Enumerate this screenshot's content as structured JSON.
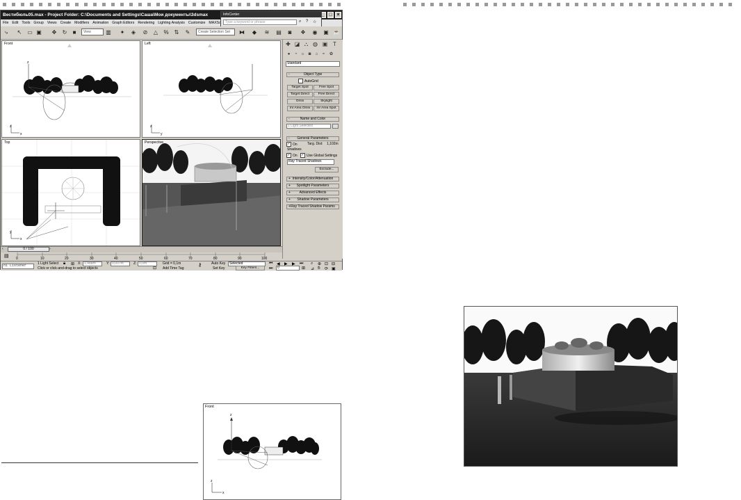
{
  "window": {
    "title": "Вестибюль05.max  - Project Folder: C:\\Documents and Settings\\Саша\\Мои документы\\3dsmax",
    "min_glyph": "_",
    "max_glyph": "□",
    "close_glyph": "×"
  },
  "infocenter": {
    "title": "InfoCenter",
    "search_placeholder": "Type a keyword or phrase"
  },
  "menu": [
    "File",
    "Edit",
    "Tools",
    "Group",
    "Views",
    "Create",
    "Modifiers",
    "Animation",
    "Graph Editors",
    "Rendering",
    "Lighting Analysis",
    "Customize",
    "MAXScript"
  ],
  "toolbar": {
    "reference_coord": "View",
    "named_selection": "Create Selection Set"
  },
  "viewports": {
    "front": "Front",
    "left": "Left",
    "top": "Top",
    "perspective": "Perspective"
  },
  "axes": {
    "x": "x",
    "y": "y",
    "z": "z"
  },
  "command_panel": {
    "category_dropdown": "Standard",
    "object_type": {
      "header": "Object Type",
      "autogrid": "AutoGrid",
      "buttons": [
        "Target Spot",
        "Free Spot",
        "Target Direct",
        "Free Direct",
        "Omni",
        "Skylight",
        "mr Area Omni",
        "mr Area Spot"
      ]
    },
    "name_and_color": {
      "header": "Name and Color",
      "name_value": "1 Light Selected"
    },
    "general_parameters": {
      "header": "General Parameters",
      "on_label": "On",
      "targ_dist_label": "Targ. Dist:",
      "targ_dist_value": "1,102m",
      "shadows_label": "Shadows",
      "shadows_on": "On",
      "use_global": "Use Global Settings",
      "shadow_type": "Ray Traced Shadows",
      "exclude": "Exclude..."
    },
    "rollouts": [
      "Intensity/Color/Attenuation",
      "Spotlight Parameters",
      "Advanced Effects",
      "Shadow Parameters",
      "Ray Traced Shadow Params"
    ]
  },
  "timeline": {
    "slider": "0 / 100",
    "ticks": [
      "0",
      "10",
      "20",
      "30",
      "40",
      "50",
      "60",
      "70",
      "80",
      "90",
      "100"
    ]
  },
  "status": {
    "maxscript_listener": "ni Listener",
    "selection_info": "1 Light Select",
    "x_label": "X:",
    "x_value": "1,488m",
    "y_label": "Y:",
    "y_value": "0,007m",
    "z_label": "Z:",
    "z_value": "0,0m",
    "grid": "Grid = 0,1m",
    "prompt": "Click or click-and-drag to select objects",
    "add_time_tag": "Add Time Tag",
    "auto_key": "Auto Key",
    "auto_key_set": "Selected",
    "set_key": "Set Key",
    "key_filters": "Key Filters...",
    "frame": "0"
  },
  "figure_front": {
    "label": "Front"
  }
}
